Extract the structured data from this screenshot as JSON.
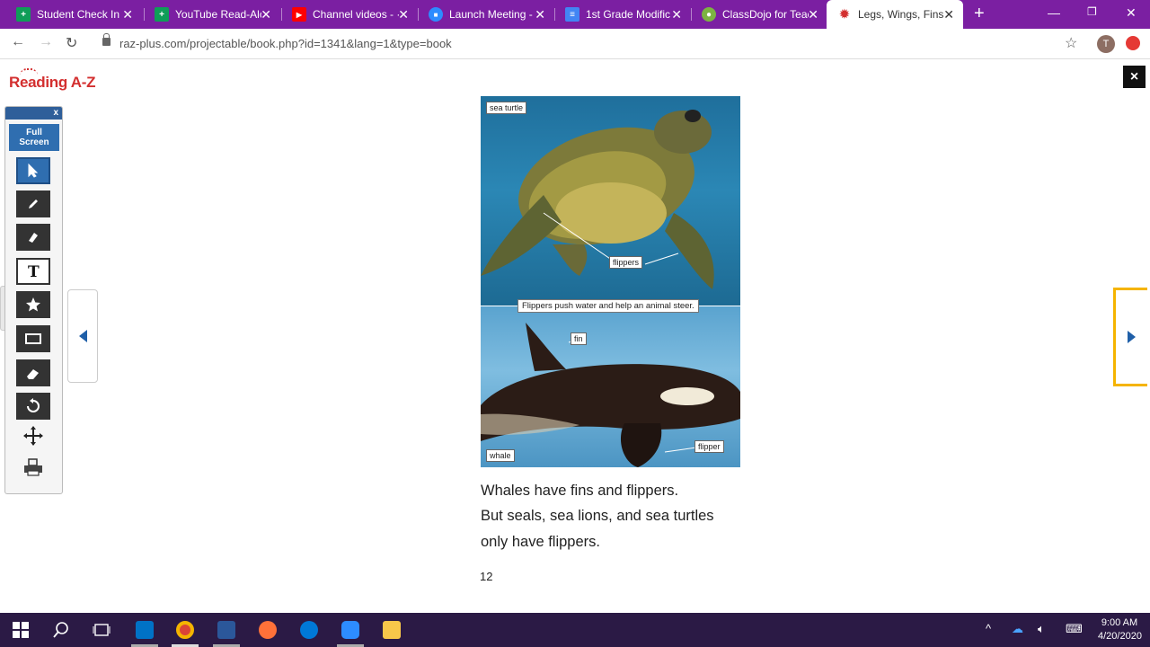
{
  "browser": {
    "tabs": [
      {
        "title": "Student Check In I",
        "icon": "google-sheets-icon",
        "color": "#0f9d58",
        "glyph": "+"
      },
      {
        "title": "YouTube Read-Alc",
        "icon": "google-sheets-icon",
        "color": "#0f9d58",
        "glyph": "+"
      },
      {
        "title": "Channel videos - ·",
        "icon": "youtube-icon",
        "color": "#ff0000",
        "glyph": "▶"
      },
      {
        "title": "Launch Meeting -",
        "icon": "zoom-icon",
        "color": "#2d8cff",
        "glyph": "■"
      },
      {
        "title": "1st Grade Modific",
        "icon": "google-docs-icon",
        "color": "#4285f4",
        "glyph": "≡"
      },
      {
        "title": "ClassDojo for Teac",
        "icon": "classdojo-icon",
        "color": "#7cb342",
        "glyph": "●"
      },
      {
        "title": "Legs, Wings, Fins,",
        "icon": "reading-az-icon",
        "color": "#d32f2f",
        "glyph": "✹"
      }
    ],
    "active_tab": 6,
    "url": "raz-plus.com/projectable/book.php?id=1341&lang=1&type=book",
    "profile_initial": "T"
  },
  "viewer": {
    "logo": "Reading A-Z",
    "close_label": "×",
    "panel_close": "x",
    "fullscreen_label_1": "Full",
    "fullscreen_label_2": "Screen"
  },
  "page": {
    "photo_labels": {
      "sea_turtle": "sea turtle",
      "flippers": "flippers",
      "fin": "fin",
      "whale": "whale",
      "flipper": "flipper"
    },
    "caption": "Flippers push water and help an animal steer.",
    "lines": [
      "Whales have fins and flippers.",
      "But seals, sea lions, and sea turtles",
      "only have flippers."
    ],
    "page_number": "12"
  },
  "taskbar": {
    "time": "9:00 AM",
    "date": "4/20/2020"
  }
}
